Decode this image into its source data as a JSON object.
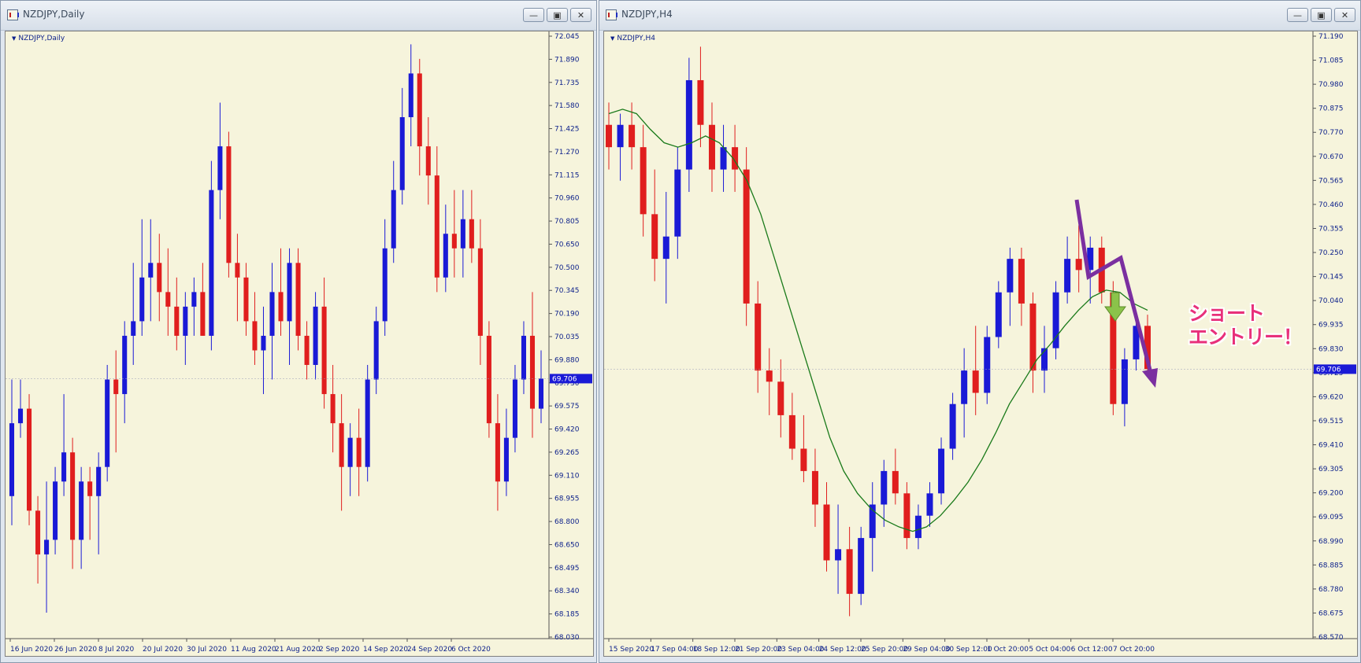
{
  "windows": {
    "left": {
      "title": "NZDJPY,Daily",
      "label": "NZDJPY,Daily"
    },
    "right": {
      "title": "NZDJPY,H4",
      "label": "NZDJPY,H4"
    },
    "buttons": {
      "minimize": "—",
      "restore": "▣",
      "close": "✕"
    }
  },
  "annotation": {
    "line1": "ショート",
    "line2": "エントリー！"
  },
  "colors": {
    "bull": "#1a1ad6",
    "bear": "#e01e1e",
    "ma": "#1a7a1a",
    "arrow": "#7b2fa0",
    "bid_bg": "#1a1ad6",
    "axis_text": "#0b1f8a"
  },
  "chart_data": [
    {
      "type": "candlestick",
      "title": "NZDJPY,Daily",
      "y_ticks": [
        "72.045",
        "71.890",
        "71.735",
        "71.580",
        "71.425",
        "71.270",
        "71.115",
        "70.960",
        "70.805",
        "70.650",
        "70.500",
        "70.345",
        "70.190",
        "70.035",
        "69.880",
        "69.730",
        "69.575",
        "69.420",
        "69.265",
        "69.110",
        "68.955",
        "68.800",
        "68.650",
        "68.495",
        "68.340",
        "68.185",
        "68.030"
      ],
      "x_ticks": [
        "16 Jun 2020",
        "26 Jun 2020",
        "8 Jul 2020",
        "20 Jul 2020",
        "30 Jul 2020",
        "11 Aug 2020",
        "21 Aug 2020",
        "2 Sep 2020",
        "14 Sep 2020",
        "24 Sep 2020",
        "6 Oct 2020"
      ],
      "current_price": "69.706",
      "ylim": [
        68.03,
        72.045
      ],
      "candles": [
        [
          68.9,
          69.7,
          68.7,
          69.4
        ],
        [
          69.4,
          69.7,
          69.3,
          69.5
        ],
        [
          69.5,
          69.6,
          68.7,
          68.8
        ],
        [
          68.8,
          68.9,
          68.3,
          68.5
        ],
        [
          68.5,
          69.0,
          68.1,
          68.6
        ],
        [
          68.6,
          69.1,
          68.5,
          69.0
        ],
        [
          69.0,
          69.6,
          68.9,
          69.2
        ],
        [
          69.2,
          69.3,
          68.4,
          68.6
        ],
        [
          68.6,
          69.1,
          68.4,
          69.0
        ],
        [
          69.0,
          69.1,
          68.6,
          68.9
        ],
        [
          68.9,
          69.2,
          68.5,
          69.1
        ],
        [
          69.1,
          69.8,
          69.0,
          69.7
        ],
        [
          69.7,
          69.9,
          69.2,
          69.6
        ],
        [
          69.6,
          70.1,
          69.4,
          70.0
        ],
        [
          70.0,
          70.5,
          69.8,
          70.1
        ],
        [
          70.1,
          70.8,
          70.0,
          70.4
        ],
        [
          70.4,
          70.8,
          70.1,
          70.5
        ],
        [
          70.5,
          70.7,
          70.1,
          70.3
        ],
        [
          70.3,
          70.6,
          70.0,
          70.2
        ],
        [
          70.2,
          70.4,
          69.9,
          70.0
        ],
        [
          70.0,
          70.3,
          69.8,
          70.2
        ],
        [
          70.2,
          70.4,
          70.0,
          70.3
        ],
        [
          70.3,
          70.5,
          70.0,
          70.0
        ],
        [
          70.0,
          71.2,
          69.9,
          71.0
        ],
        [
          71.0,
          71.6,
          70.8,
          71.3
        ],
        [
          71.3,
          71.4,
          70.4,
          70.5
        ],
        [
          70.5,
          70.7,
          70.1,
          70.4
        ],
        [
          70.4,
          70.5,
          70.0,
          70.1
        ],
        [
          70.1,
          70.3,
          69.8,
          69.9
        ],
        [
          69.9,
          70.2,
          69.6,
          70.0
        ],
        [
          70.0,
          70.5,
          69.7,
          70.3
        ],
        [
          70.3,
          70.6,
          70.0,
          70.1
        ],
        [
          70.1,
          70.6,
          69.8,
          70.5
        ],
        [
          70.5,
          70.6,
          69.9,
          70.0
        ],
        [
          70.0,
          70.1,
          69.7,
          69.8
        ],
        [
          69.8,
          70.3,
          69.7,
          70.2
        ],
        [
          70.2,
          70.4,
          69.5,
          69.6
        ],
        [
          69.6,
          69.8,
          69.2,
          69.4
        ],
        [
          69.4,
          69.6,
          68.8,
          69.1
        ],
        [
          69.1,
          69.4,
          68.9,
          69.3
        ],
        [
          69.3,
          69.5,
          68.9,
          69.1
        ],
        [
          69.1,
          69.8,
          69.0,
          69.7
        ],
        [
          69.7,
          70.2,
          69.6,
          70.1
        ],
        [
          70.1,
          70.8,
          70.0,
          70.6
        ],
        [
          70.6,
          71.2,
          70.5,
          71.0
        ],
        [
          71.0,
          71.7,
          70.9,
          71.5
        ],
        [
          71.5,
          72.0,
          71.3,
          71.8
        ],
        [
          71.8,
          71.9,
          71.1,
          71.3
        ],
        [
          71.3,
          71.5,
          70.9,
          71.1
        ],
        [
          71.1,
          71.3,
          70.3,
          70.4
        ],
        [
          70.4,
          70.9,
          70.3,
          70.7
        ],
        [
          70.7,
          71.0,
          70.4,
          70.6
        ],
        [
          70.6,
          71.0,
          70.4,
          70.8
        ],
        [
          70.8,
          71.0,
          70.5,
          70.6
        ],
        [
          70.6,
          70.8,
          69.8,
          70.0
        ],
        [
          70.0,
          70.1,
          69.3,
          69.4
        ],
        [
          69.4,
          69.6,
          68.8,
          69.0
        ],
        [
          69.0,
          69.5,
          68.9,
          69.3
        ],
        [
          69.3,
          69.8,
          69.2,
          69.7
        ],
        [
          69.7,
          70.1,
          69.6,
          70.0
        ],
        [
          70.0,
          70.3,
          69.3,
          69.5
        ],
        [
          69.5,
          69.9,
          69.4,
          69.706
        ]
      ]
    },
    {
      "type": "candlestick",
      "title": "NZDJPY,H4",
      "y_ticks": [
        "71.190",
        "71.085",
        "70.980",
        "70.875",
        "70.770",
        "70.670",
        "70.565",
        "70.460",
        "70.355",
        "70.250",
        "70.145",
        "70.040",
        "69.935",
        "69.830",
        "69.725",
        "69.620",
        "69.515",
        "69.410",
        "69.305",
        "69.200",
        "69.095",
        "68.990",
        "68.885",
        "68.780",
        "68.675",
        "68.570"
      ],
      "x_ticks": [
        "15 Sep 2020",
        "17 Sep 04:00",
        "18 Sep 12:00",
        "21 Sep 20:00",
        "23 Sep 04:00",
        "24 Sep 12:00",
        "25 Sep 20:00",
        "29 Sep 04:00",
        "30 Sep 12:00",
        "1 Oct 20:00",
        "5 Oct 04:00",
        "6 Oct 12:00",
        "7 Oct 20:00"
      ],
      "current_price": "69.706",
      "ylim": [
        68.57,
        71.19
      ],
      "candles": [
        [
          70.8,
          70.9,
          70.6,
          70.7
        ],
        [
          70.7,
          70.85,
          70.55,
          70.8
        ],
        [
          70.8,
          70.9,
          70.6,
          70.7
        ],
        [
          70.7,
          70.8,
          70.3,
          70.4
        ],
        [
          70.4,
          70.6,
          70.1,
          70.2
        ],
        [
          70.2,
          70.5,
          70.0,
          70.3
        ],
        [
          70.3,
          70.7,
          70.2,
          70.6
        ],
        [
          70.6,
          71.1,
          70.5,
          71.0
        ],
        [
          71.0,
          71.15,
          70.7,
          70.8
        ],
        [
          70.8,
          70.9,
          70.5,
          70.6
        ],
        [
          70.6,
          70.8,
          70.5,
          70.7
        ],
        [
          70.7,
          70.8,
          70.5,
          70.6
        ],
        [
          70.6,
          70.7,
          69.9,
          70.0
        ],
        [
          70.0,
          70.1,
          69.6,
          69.7
        ],
        [
          69.7,
          69.8,
          69.5,
          69.65
        ],
        [
          69.65,
          69.75,
          69.4,
          69.5
        ],
        [
          69.5,
          69.6,
          69.3,
          69.35
        ],
        [
          69.35,
          69.5,
          69.2,
          69.25
        ],
        [
          69.25,
          69.35,
          69.0,
          69.1
        ],
        [
          69.1,
          69.2,
          68.8,
          68.85
        ],
        [
          68.85,
          69.1,
          68.7,
          68.9
        ],
        [
          68.9,
          69.0,
          68.6,
          68.7
        ],
        [
          68.7,
          69.0,
          68.65,
          68.95
        ],
        [
          68.95,
          69.2,
          68.8,
          69.1
        ],
        [
          69.1,
          69.3,
          69.0,
          69.25
        ],
        [
          69.25,
          69.35,
          69.1,
          69.15
        ],
        [
          69.15,
          69.2,
          68.9,
          68.95
        ],
        [
          68.95,
          69.1,
          68.9,
          69.05
        ],
        [
          69.05,
          69.2,
          69.0,
          69.15
        ],
        [
          69.15,
          69.4,
          69.1,
          69.35
        ],
        [
          69.35,
          69.6,
          69.3,
          69.55
        ],
        [
          69.55,
          69.8,
          69.4,
          69.7
        ],
        [
          69.7,
          69.9,
          69.5,
          69.6
        ],
        [
          69.6,
          69.9,
          69.55,
          69.85
        ],
        [
          69.85,
          70.1,
          69.8,
          70.05
        ],
        [
          70.05,
          70.25,
          69.9,
          70.2
        ],
        [
          70.2,
          70.25,
          69.9,
          70.0
        ],
        [
          70.0,
          70.05,
          69.6,
          69.7
        ],
        [
          69.7,
          69.9,
          69.6,
          69.8
        ],
        [
          69.8,
          70.1,
          69.75,
          70.05
        ],
        [
          70.05,
          70.3,
          70.0,
          70.2
        ],
        [
          70.2,
          70.35,
          70.05,
          70.15
        ],
        [
          70.15,
          70.3,
          70.0,
          70.25
        ],
        [
          70.25,
          70.3,
          70.0,
          70.05
        ],
        [
          70.05,
          70.1,
          69.5,
          69.55
        ],
        [
          69.55,
          69.8,
          69.45,
          69.75
        ],
        [
          69.75,
          69.95,
          69.7,
          69.9
        ],
        [
          69.9,
          69.95,
          69.7,
          69.706
        ]
      ],
      "series": [
        {
          "name": "",
          "values": [
            70.85,
            70.87,
            70.85,
            70.78,
            70.72,
            70.7,
            70.72,
            70.75,
            70.72,
            70.65,
            70.55,
            70.4,
            70.2,
            70.0,
            69.8,
            69.6,
            69.4,
            69.25,
            69.15,
            69.08,
            69.03,
            69.0,
            68.98,
            69.0,
            69.05,
            69.12,
            69.2,
            69.3,
            69.42,
            69.55,
            69.65,
            69.75,
            69.82,
            69.9,
            69.97,
            70.03,
            70.06,
            70.05,
            70.0,
            69.97
          ]
        }
      ]
    }
  ]
}
